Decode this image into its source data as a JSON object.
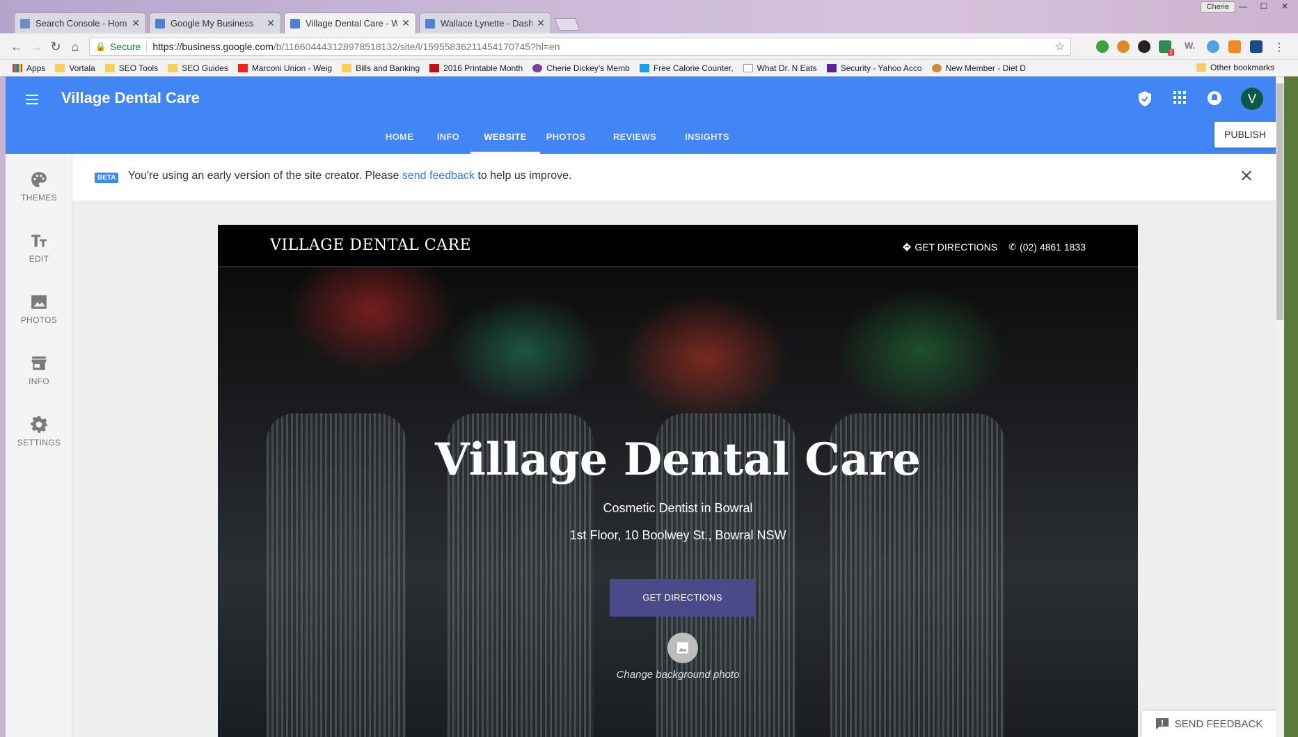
{
  "browser": {
    "profile_name": "Cherie",
    "tabs": [
      {
        "label": "Search Console - Home"
      },
      {
        "label": "Google My Business"
      },
      {
        "label": "Village Dental Care - We"
      },
      {
        "label": "Wallace Lynette - Dashb"
      }
    ],
    "address": {
      "secure_label": "Secure",
      "url_host": "https://business.google.com",
      "url_path": "/b/116604443128978518132/site/l/15955836211454170745?hl=en"
    },
    "bookmarks": [
      {
        "label": "Apps"
      },
      {
        "label": "Vortala"
      },
      {
        "label": "SEO Tools"
      },
      {
        "label": "SEO Guides"
      },
      {
        "label": "Marconi Union - Weig"
      },
      {
        "label": "Bills and Banking"
      },
      {
        "label": "2016 Printable Month"
      },
      {
        "label": "Cherie Dickey's Memb"
      },
      {
        "label": "Free Calorie Counter,"
      },
      {
        "label": "What Dr. N Eats"
      },
      {
        "label": "Security - Yahoo Acco"
      },
      {
        "label": "New Member - Diet D"
      }
    ],
    "other_bookmarks": "Other bookmarks",
    "extension_badge": "2"
  },
  "app": {
    "title": "Village Dental Care",
    "avatar_letter": "V",
    "tabs": [
      {
        "label": "HOME"
      },
      {
        "label": "INFO"
      },
      {
        "label": "WEBSITE"
      },
      {
        "label": "PHOTOS"
      },
      {
        "label": "REVIEWS"
      },
      {
        "label": "INSIGHTS"
      }
    ],
    "active_tab": "WEBSITE",
    "publish_label": "PUBLISH",
    "sidebar": [
      {
        "label": "THEMES",
        "icon": "palette-icon"
      },
      {
        "label": "EDIT",
        "icon": "text-format-icon"
      },
      {
        "label": "PHOTOS",
        "icon": "image-icon"
      },
      {
        "label": "INFO",
        "icon": "store-icon"
      },
      {
        "label": "SETTINGS",
        "icon": "gear-icon"
      }
    ],
    "beta": {
      "badge": "BETA",
      "text_before": "You're using an early version of the site creator. Please ",
      "link": "send feedback",
      "text_after": " to help us improve."
    },
    "send_feedback_label": "SEND FEEDBACK"
  },
  "site": {
    "logo": "VILLAGE DENTAL CARE",
    "directions_link": "GET DIRECTIONS",
    "phone": "(02) 4861 1833",
    "hero_title": "Village Dental Care",
    "hero_subtitle": "Cosmetic Dentist in Bowral",
    "hero_address": "1st Floor, 10 Boolwey St., Bowral NSW",
    "cta_label": "GET DIRECTIONS",
    "change_photo_label": "Change background photo"
  },
  "colors": {
    "appbar": "#4285f4",
    "cta": "#4a4a8a",
    "avatar": "#0d5848"
  }
}
